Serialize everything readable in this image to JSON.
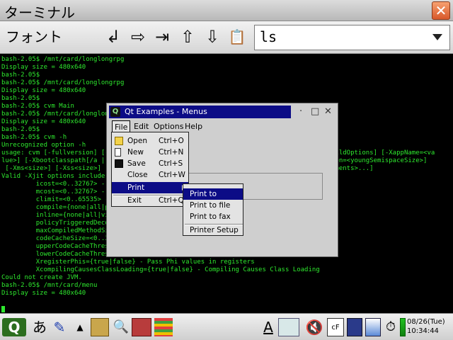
{
  "window": {
    "title": "ターミナル",
    "close_glyph": "✕"
  },
  "toolbar": {
    "font_label": "フォント",
    "buttons": [
      {
        "name": "return-key-icon",
        "glyph": "↲"
      },
      {
        "name": "arrow-right-icon",
        "glyph": "⇨"
      },
      {
        "name": "tab-key-icon",
        "glyph": "⇥"
      },
      {
        "name": "arrow-up-icon",
        "glyph": "⇧"
      },
      {
        "name": "arrow-down-icon",
        "glyph": "⇩"
      },
      {
        "name": "clipboard-paste-icon",
        "glyph": "📋"
      }
    ],
    "command_value": "ls"
  },
  "terminal": {
    "lines": [
      "bash-2.05$ /mnt/card/longlongrpg",
      "Display size = 480x640",
      "bash-2.05$",
      "bash-2.05$ /mnt/card/longlongrpg",
      "Display size = 480x640",
      "bash-2.05$",
      "bash-2.05$ cvm Main",
      "bash-2.05$ /mnt/card/longlongr",
      "Display size = 480x640",
      "bash-2.05$",
      "bash-2.05$ cvm -h",
      "Unrecognized option -h",
      "usage: cvm [-fullversion] [-sh                                                   showBuildOptions] [-XappName=<va",
      "lue>] [-Xbootclasspath[/a | /p                                                  <youngGen=<youngSemispaceSize>]",
      " [-Xms<size>] [-Xss<size>] [-X                                                   [<arguments>...]",
      "Valid -Xjit options include:",
      "         icost=<0..32767> - Int",
      "         mcost=<0..32767> - Mi",
      "         climit=<0..65535> - Co",
      "         compile={none|all|poli",
      "         inline={none|all|virtu",
      "         policyTriggeredDecompi",
      "         maxCompiledMethodSize=",
      "         codeCacheSize=<0..3355",
      "         upperCodeCacheThreshold",
      "         lowerCodeCacheThreshold=<0%..100%> - Lower Code Cache Threshold",
      "         XregisterPhis={true|false} - Pass Phi values in registers",
      "         XcompilingCausesClassLoading={true|false} - Compiling Causes Class Loading",
      "Could not create JVM.",
      "bash-2.05$ /mnt/card/menu",
      "Display size = 480x640"
    ]
  },
  "qt_window": {
    "title": "Qt Examples - Menus",
    "logo_text": "Q",
    "title_buttons": [
      "·",
      "□",
      "✕"
    ],
    "menubar": [
      "File",
      "Edit",
      "Options",
      "Help"
    ]
  },
  "file_menu": {
    "items": [
      {
        "label": "Open",
        "shortcut": "Ctrl+O",
        "icon": "folder-icon"
      },
      {
        "label": "New",
        "shortcut": "Ctrl+N",
        "icon": "new-file-icon"
      },
      {
        "label": "Save",
        "shortcut": "Ctrl+S",
        "icon": "floppy-icon"
      },
      {
        "label": "Close",
        "shortcut": "Ctrl+W",
        "icon": ""
      },
      {
        "label": "Print",
        "shortcut": "",
        "icon": ""
      },
      {
        "label": "Exit",
        "shortcut": "Ctrl+Q",
        "icon": ""
      }
    ]
  },
  "print_menu": {
    "items": [
      "Print to printer",
      "Print to file",
      "Print to fax",
      "Printer Setup"
    ]
  },
  "taskbar": {
    "date": "08/26(Tue)",
    "time": "10:34:44",
    "input_mode": "あ",
    "underline_a": "A"
  }
}
